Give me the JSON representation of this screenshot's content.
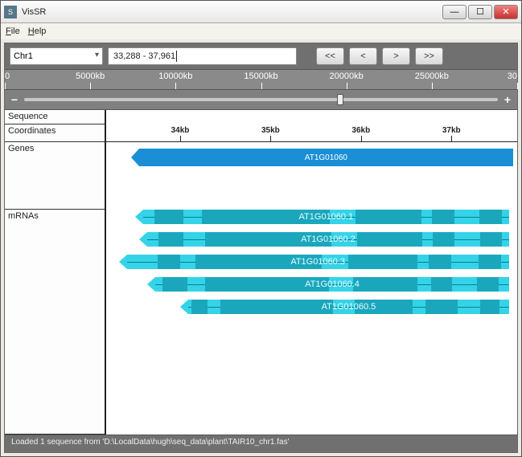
{
  "window": {
    "title": "VisSR"
  },
  "menu": {
    "file": "File",
    "help": "Help"
  },
  "toolbar": {
    "chrom": "Chr1",
    "range": "33,288 - 37,961",
    "nav_first": "<<",
    "nav_prev": "<",
    "nav_next": ">",
    "nav_last": ">>"
  },
  "overview": {
    "ticks": [
      "0",
      "5000kb",
      "10000kb",
      "15000kb",
      "20000kb",
      "25000kb",
      "30"
    ]
  },
  "slider": {
    "pos_pct": 66
  },
  "tracks": {
    "sequence": "Sequence",
    "coordinates": "Coordinates",
    "genes": "Genes",
    "mrnas": "mRNAs"
  },
  "coord_ticks": [
    "34kb",
    "35kb",
    "36kb",
    "37kb"
  ],
  "gene": {
    "label": "AT1G01060",
    "left_pct": 8,
    "width_pct": 91
  },
  "mrnas": [
    {
      "label": "AT1G01060.1",
      "left_pct": 9,
      "width_pct": 89,
      "exons": [
        [
          3,
          8
        ],
        [
          16,
          35
        ],
        [
          58,
          18
        ],
        [
          79,
          6
        ],
        [
          92,
          6
        ]
      ]
    },
    {
      "label": "AT1G01060.2",
      "left_pct": 10,
      "width_pct": 88,
      "exons": [
        [
          3,
          7
        ],
        [
          16,
          35
        ],
        [
          58,
          18
        ],
        [
          79,
          6
        ],
        [
          92,
          6
        ]
      ]
    },
    {
      "label": "AT1G01060.3",
      "left_pct": 5,
      "width_pct": 93,
      "exons": [
        [
          8,
          6
        ],
        [
          18,
          33
        ],
        [
          58,
          18
        ],
        [
          79,
          6
        ],
        [
          92,
          6
        ]
      ]
    },
    {
      "label": "AT1G01060.4",
      "left_pct": 12,
      "width_pct": 86,
      "exons": [
        [
          2,
          7
        ],
        [
          14,
          35
        ],
        [
          56,
          18
        ],
        [
          78,
          6
        ],
        [
          91,
          6
        ]
      ]
    },
    {
      "label": "AT1G01060.5",
      "left_pct": 20,
      "width_pct": 78,
      "exons": [
        [
          1,
          5
        ],
        [
          10,
          35
        ],
        [
          52,
          18
        ],
        [
          74,
          10
        ],
        [
          91,
          6
        ]
      ]
    }
  ],
  "status": "Loaded 1 sequence from 'D:\\LocalData\\hugh\\seq_data\\plant\\TAIR10_chr1.fas'"
}
